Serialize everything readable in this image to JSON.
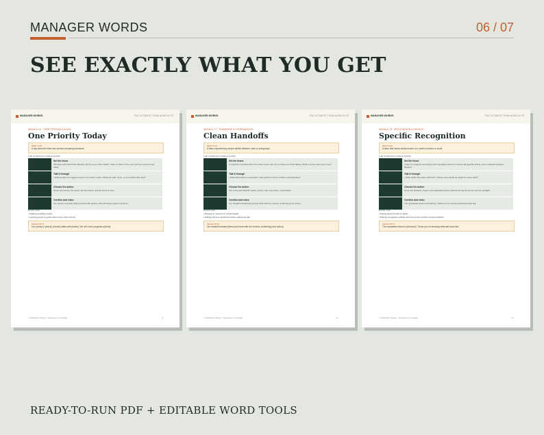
{
  "header": {
    "brand": "MANAGER WORDS",
    "page_indicator": "06 / 07"
  },
  "headline": "SEE EXACTLY WHAT YOU GET",
  "footer_text": "READY-TO-RUN PDF  +  EDITABLE WORD TOOLS",
  "sheet_common": {
    "brand": "MANAGER WORDS",
    "right_title": "THE ULTIMATE TEAM HUDDLE KIT",
    "best_for_label": "BEST FOR",
    "steps_label": "THE 15-MINUTE HUDDLE SCRIPT",
    "avoid_label": "AVOID THIS",
    "leave_label": "LEAVE WITH",
    "copyright": "© 2026 Bob Pickett · Substitute not limited"
  },
  "sheets": [
    {
      "module": "MODULE 01 · START STRONG & ALIGN",
      "title": "One Priority Today",
      "best_for": "A day when the team has several competing demands.",
      "steps": [
        {
          "heading": "Set the focus",
          "desc": "We have work which that attention. By the end of this huddle, I want us clear on the one result we commit most today."
        },
        {
          "heading": "Talk it through",
          "desc": "• What creates the biggest impact if we finish it well? • What can wait, move, or be handled after that?"
        },
        {
          "heading": "Choose the action",
          "desc": "Name one priority, the owner, the first action, and the check-in time."
        },
        {
          "heading": "Confirm and close",
          "desc": "Our priority is [result]. [Owner] starts with [action]. We will check progress at [time]."
        }
      ],
      "avoid": [
        "• Calling everything urgent",
        "• Leaving people to guess what moves down the list"
      ],
      "leave_with": "Our priority is [result]. [Owner] starts with [action]. We will check progress at [time].",
      "page": "4"
    },
    {
      "module": "MODULE 17 · TEAMWORK & COORDINATION",
      "title": "Clean Handoffs",
      "best_for": "A team experiencing missed details between roles or workgroups.",
      "steps": [
        {
          "heading": "Set the focus",
          "desc": "A handoff is complete when the other person can act, not when we finish talking. What must be clear every time?"
        },
        {
          "heading": "Talk it through",
          "desc": "• What information is essential? • How will the receiver confirm understanding?"
        },
        {
          "heading": "Choose the action",
          "desc": "Use a five-part handoff: status, priority, risk, next action, confirmation."
        },
        {
          "heading": "Confirm and close",
          "desc": "Our handoff includes [items] and ends with the receiver confirming [next action]."
        }
      ],
      "avoid": [
        "• Relying on memory for critical details",
        "• Ending with any questions? before stating the ask"
      ],
      "leave_with": "Our handoff includes [items] and ends with the receiver confirming [next action].",
      "page": "21"
    },
    {
      "module": "MODULE 23 · RECOGNITION & GROWTH",
      "title": "Specific Recognition",
      "best_for": "A team that needs reinforcement of a useful behavior or result.",
      "steps": [
        {
          "heading": "Set the focus",
          "desc": "I want to recognize something worth repeating. [Person or team] did [specific action], and it mattered because [impact]."
        },
        {
          "heading": "Talk it through",
          "desc": "• What made that action effective? • Where else should we apply the same habit?"
        },
        {
          "heading": "Choose the action",
          "desc": "Name the behavior, impact, and repeatable lesson without forcing the person into the spotlight."
        },
        {
          "heading": "Confirm and close",
          "desc": "The repeatable lesson is [behavior]. Thank you for showing what that looks like."
        }
      ],
      "avoid": [
        "• Saying great job with no detail",
        "• Sharing recognition publicly when the person prefers private feedback"
      ],
      "leave_with": "The repeatable lesson is [behavior]. Thank you for showing what that looks like.",
      "page": "31"
    }
  ],
  "colors": {
    "background": "#e3e7e0",
    "accent": "#c2602f",
    "ink": "#1e2b26",
    "thumb": "#1c3a2e"
  }
}
